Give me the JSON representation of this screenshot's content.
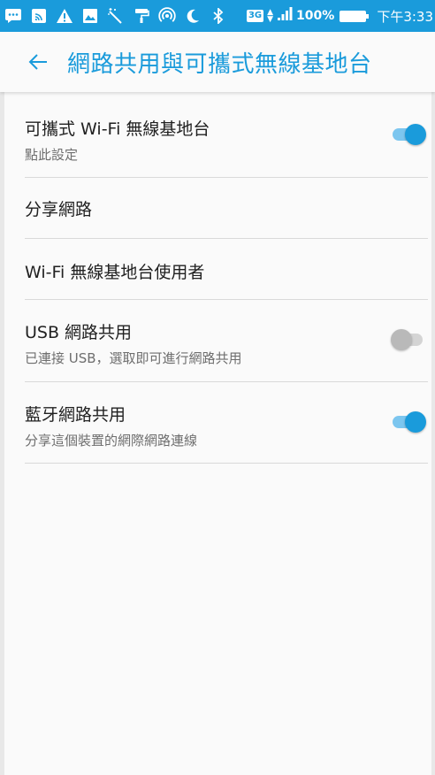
{
  "status_bar": {
    "icons": [
      "chat-icon",
      "cast-icon",
      "warning-icon",
      "image-icon",
      "magic-wand-icon",
      "paint-roller-icon",
      "hotspot-icon",
      "moon-icon",
      "bluetooth-icon"
    ],
    "network": "3G",
    "battery": "100%",
    "time": "下午3:33"
  },
  "app_bar": {
    "title": "網路共用與可攜式無線基地台"
  },
  "settings": [
    {
      "title": "可攜式 Wi-Fi 無線基地台",
      "subtitle": "點此設定",
      "toggle": true
    },
    {
      "title": "分享網路"
    },
    {
      "title": "Wi-Fi 無線基地台使用者"
    },
    {
      "title": "USB 網路共用",
      "subtitle": "已連接 USB，選取即可進行網路共用",
      "toggle": false
    },
    {
      "title": "藍牙網路共用",
      "subtitle": "分享這個裝置的網際網路連線",
      "toggle": true
    }
  ],
  "colors": {
    "accent": "#1a9bdb",
    "toggle_on_track": "#7cc6ef",
    "toggle_off_thumb": "#b9b9b9",
    "background": "#fafafa"
  }
}
